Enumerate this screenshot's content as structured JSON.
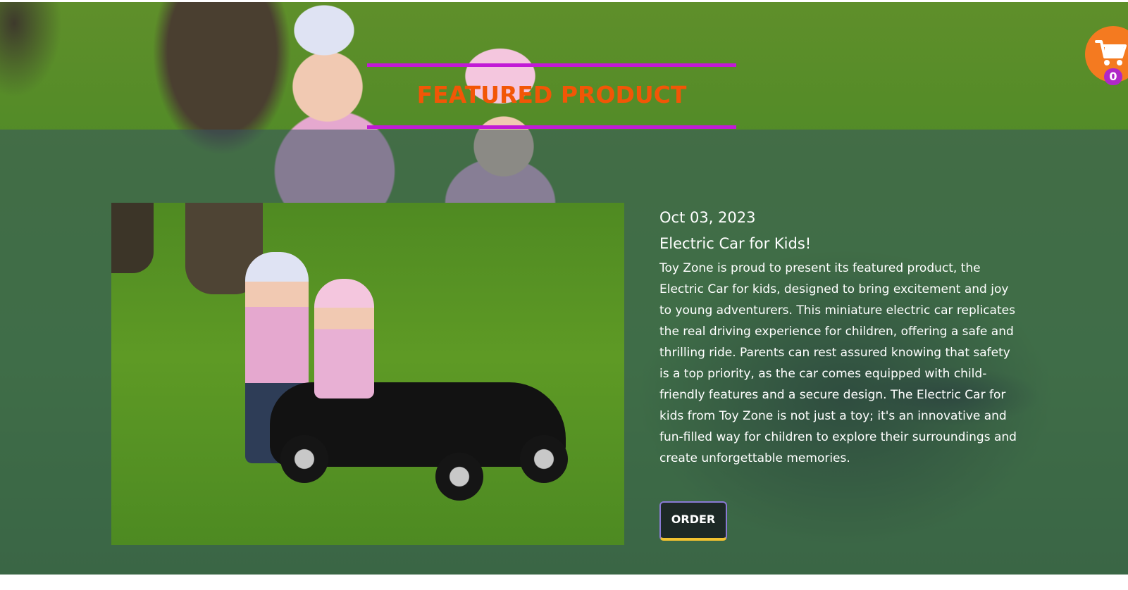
{
  "section": {
    "heading": "FEATURED PRODUCT"
  },
  "cart": {
    "icon": "cart-icon",
    "count": "0"
  },
  "product": {
    "date": "Oct 03, 2023",
    "title": "Electric Car for Kids!",
    "description": "Toy Zone is proud to present its featured product, the Electric Car for kids, designed to bring excitement and joy to young adventurers. This miniature electric car replicates the real driving experience for children, offering a safe and thrilling ride. Parents can rest assured knowing that safety is a top priority, as the car comes equipped with child-friendly features and a secure design. The Electric Car for kids from Toy Zone is not just a toy; it's an innovative and fun-filled way for children to explore their surroundings and create unforgettable memories.",
    "order_label": "ORDER"
  },
  "colors": {
    "heading": "#f25606",
    "heading_lines": "#c21ad6",
    "cart": "#f47a20",
    "cart_badge": "#b028c8",
    "button_accent": "#f2c230"
  }
}
